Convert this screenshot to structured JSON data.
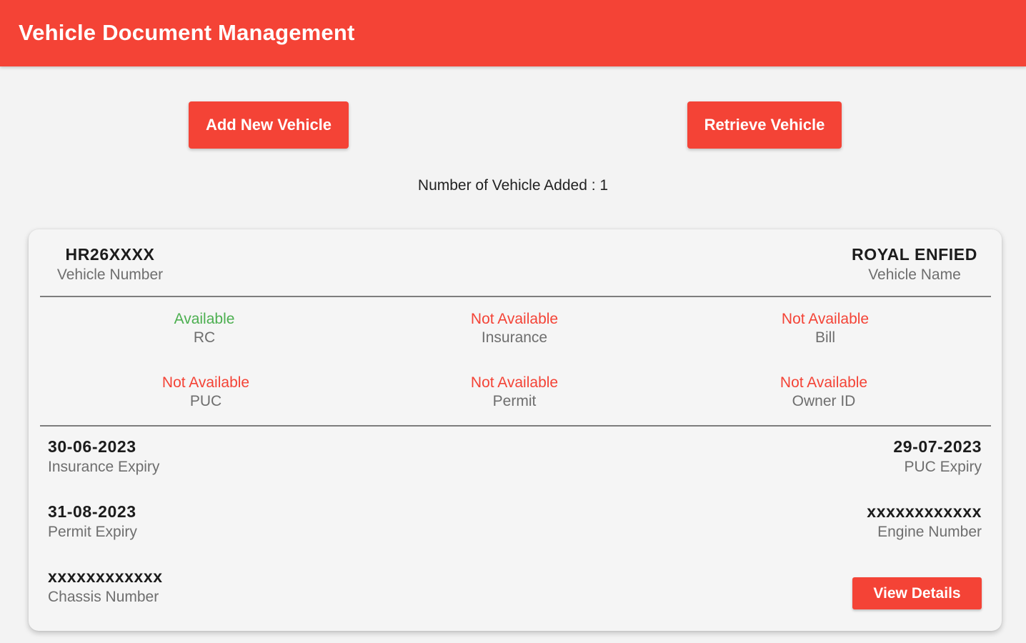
{
  "app": {
    "title": "Vehicle Document Management",
    "accent_color": "#f44336"
  },
  "actions": {
    "add_label": "Add New Vehicle",
    "retrieve_label": "Retrieve Vehicle"
  },
  "summary": {
    "count_text": "Number of Vehicle Added : 1"
  },
  "vehicle_card": {
    "vehicle_number": "HR26XXXX",
    "vehicle_number_label": "Vehicle Number",
    "vehicle_name": "ROYAL ENFIED",
    "vehicle_name_label": "Vehicle Name",
    "documents": [
      {
        "status": "Available",
        "name": "RC",
        "status_color": "#4caf50"
      },
      {
        "status": "Not Available",
        "name": "Insurance",
        "status_color": "#f44336"
      },
      {
        "status": "Not Available",
        "name": "Bill",
        "status_color": "#f44336"
      },
      {
        "status": "Not Available",
        "name": "PUC",
        "status_color": "#f44336"
      },
      {
        "status": "Not Available",
        "name": "Permit",
        "status_color": "#f44336"
      },
      {
        "status": "Not Available",
        "name": "Owner ID",
        "status_color": "#f44336"
      }
    ],
    "insurance_expiry": "30-06-2023",
    "insurance_expiry_label": "Insurance Expiry",
    "puc_expiry": "29-07-2023",
    "puc_expiry_label": "PUC Expiry",
    "permit_expiry": "31-08-2023",
    "permit_expiry_label": "Permit Expiry",
    "engine_number": "xxxxxxxxxxxx",
    "engine_number_label": "Engine Number",
    "chassis_number": "xxxxxxxxxxxx",
    "chassis_number_label": "Chassis Number",
    "view_details_label": "View Details"
  }
}
